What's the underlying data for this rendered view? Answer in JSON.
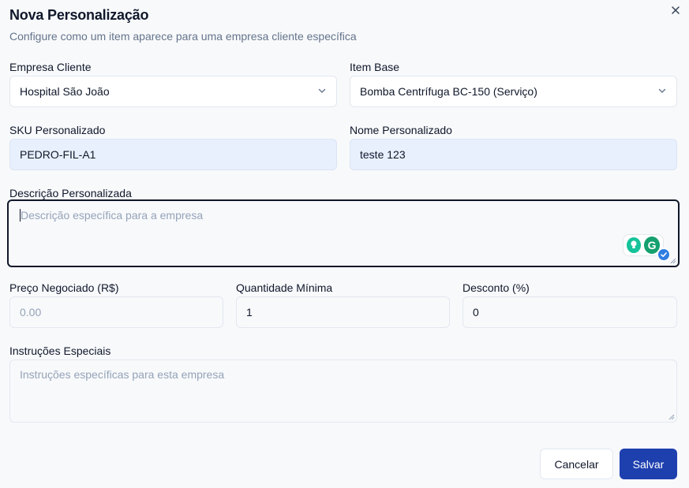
{
  "dialog": {
    "title": "Nova Personalização",
    "subtitle": "Configure como um item aparece para uma empresa cliente específica",
    "close_icon": "close-icon"
  },
  "form": {
    "empresa": {
      "label": "Empresa Cliente",
      "value": "Hospital São João"
    },
    "item_base": {
      "label": "Item Base",
      "value": "Bomba Centrífuga BC-150 (Serviço)"
    },
    "sku": {
      "label": "SKU Personalizado",
      "value": "PEDRO-FIL-A1"
    },
    "nome": {
      "label": "Nome Personalizado",
      "value": "teste 123"
    },
    "descricao": {
      "label": "Descrição Personalizada",
      "placeholder": "Descrição específica para a empresa"
    },
    "preco": {
      "label": "Preço Negociado (R$)",
      "placeholder": "0.00"
    },
    "quantidade": {
      "label": "Quantidade Mínima",
      "value": "1"
    },
    "desconto": {
      "label": "Desconto (%)",
      "value": "0"
    },
    "instrucoes": {
      "label": "Instruções Especiais",
      "placeholder": "Instruções específicas para esta empresa"
    }
  },
  "actions": {
    "cancel_label": "Cancelar",
    "save_label": "Salvar"
  },
  "colors": {
    "primary": "#1e40af",
    "filled_input": "#e8f0fe",
    "grammarly": "#15c39a"
  }
}
